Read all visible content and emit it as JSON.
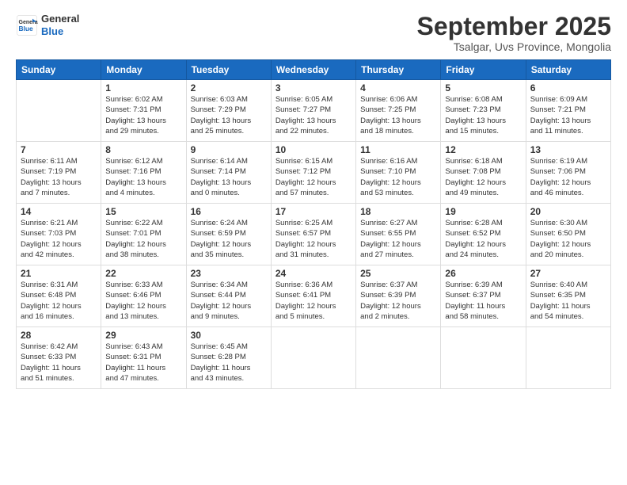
{
  "logo": {
    "line1": "General",
    "line2": "Blue"
  },
  "title": "September 2025",
  "location": "Tsalgar, Uvs Province, Mongolia",
  "days_of_week": [
    "Sunday",
    "Monday",
    "Tuesday",
    "Wednesday",
    "Thursday",
    "Friday",
    "Saturday"
  ],
  "weeks": [
    [
      {
        "day": "",
        "info": ""
      },
      {
        "day": "1",
        "info": "Sunrise: 6:02 AM\nSunset: 7:31 PM\nDaylight: 13 hours\nand 29 minutes."
      },
      {
        "day": "2",
        "info": "Sunrise: 6:03 AM\nSunset: 7:29 PM\nDaylight: 13 hours\nand 25 minutes."
      },
      {
        "day": "3",
        "info": "Sunrise: 6:05 AM\nSunset: 7:27 PM\nDaylight: 13 hours\nand 22 minutes."
      },
      {
        "day": "4",
        "info": "Sunrise: 6:06 AM\nSunset: 7:25 PM\nDaylight: 13 hours\nand 18 minutes."
      },
      {
        "day": "5",
        "info": "Sunrise: 6:08 AM\nSunset: 7:23 PM\nDaylight: 13 hours\nand 15 minutes."
      },
      {
        "day": "6",
        "info": "Sunrise: 6:09 AM\nSunset: 7:21 PM\nDaylight: 13 hours\nand 11 minutes."
      }
    ],
    [
      {
        "day": "7",
        "info": "Sunrise: 6:11 AM\nSunset: 7:19 PM\nDaylight: 13 hours\nand 7 minutes."
      },
      {
        "day": "8",
        "info": "Sunrise: 6:12 AM\nSunset: 7:16 PM\nDaylight: 13 hours\nand 4 minutes."
      },
      {
        "day": "9",
        "info": "Sunrise: 6:14 AM\nSunset: 7:14 PM\nDaylight: 13 hours\nand 0 minutes."
      },
      {
        "day": "10",
        "info": "Sunrise: 6:15 AM\nSunset: 7:12 PM\nDaylight: 12 hours\nand 57 minutes."
      },
      {
        "day": "11",
        "info": "Sunrise: 6:16 AM\nSunset: 7:10 PM\nDaylight: 12 hours\nand 53 minutes."
      },
      {
        "day": "12",
        "info": "Sunrise: 6:18 AM\nSunset: 7:08 PM\nDaylight: 12 hours\nand 49 minutes."
      },
      {
        "day": "13",
        "info": "Sunrise: 6:19 AM\nSunset: 7:06 PM\nDaylight: 12 hours\nand 46 minutes."
      }
    ],
    [
      {
        "day": "14",
        "info": "Sunrise: 6:21 AM\nSunset: 7:03 PM\nDaylight: 12 hours\nand 42 minutes."
      },
      {
        "day": "15",
        "info": "Sunrise: 6:22 AM\nSunset: 7:01 PM\nDaylight: 12 hours\nand 38 minutes."
      },
      {
        "day": "16",
        "info": "Sunrise: 6:24 AM\nSunset: 6:59 PM\nDaylight: 12 hours\nand 35 minutes."
      },
      {
        "day": "17",
        "info": "Sunrise: 6:25 AM\nSunset: 6:57 PM\nDaylight: 12 hours\nand 31 minutes."
      },
      {
        "day": "18",
        "info": "Sunrise: 6:27 AM\nSunset: 6:55 PM\nDaylight: 12 hours\nand 27 minutes."
      },
      {
        "day": "19",
        "info": "Sunrise: 6:28 AM\nSunset: 6:52 PM\nDaylight: 12 hours\nand 24 minutes."
      },
      {
        "day": "20",
        "info": "Sunrise: 6:30 AM\nSunset: 6:50 PM\nDaylight: 12 hours\nand 20 minutes."
      }
    ],
    [
      {
        "day": "21",
        "info": "Sunrise: 6:31 AM\nSunset: 6:48 PM\nDaylight: 12 hours\nand 16 minutes."
      },
      {
        "day": "22",
        "info": "Sunrise: 6:33 AM\nSunset: 6:46 PM\nDaylight: 12 hours\nand 13 minutes."
      },
      {
        "day": "23",
        "info": "Sunrise: 6:34 AM\nSunset: 6:44 PM\nDaylight: 12 hours\nand 9 minutes."
      },
      {
        "day": "24",
        "info": "Sunrise: 6:36 AM\nSunset: 6:41 PM\nDaylight: 12 hours\nand 5 minutes."
      },
      {
        "day": "25",
        "info": "Sunrise: 6:37 AM\nSunset: 6:39 PM\nDaylight: 12 hours\nand 2 minutes."
      },
      {
        "day": "26",
        "info": "Sunrise: 6:39 AM\nSunset: 6:37 PM\nDaylight: 11 hours\nand 58 minutes."
      },
      {
        "day": "27",
        "info": "Sunrise: 6:40 AM\nSunset: 6:35 PM\nDaylight: 11 hours\nand 54 minutes."
      }
    ],
    [
      {
        "day": "28",
        "info": "Sunrise: 6:42 AM\nSunset: 6:33 PM\nDaylight: 11 hours\nand 51 minutes."
      },
      {
        "day": "29",
        "info": "Sunrise: 6:43 AM\nSunset: 6:31 PM\nDaylight: 11 hours\nand 47 minutes."
      },
      {
        "day": "30",
        "info": "Sunrise: 6:45 AM\nSunset: 6:28 PM\nDaylight: 11 hours\nand 43 minutes."
      },
      {
        "day": "",
        "info": ""
      },
      {
        "day": "",
        "info": ""
      },
      {
        "day": "",
        "info": ""
      },
      {
        "day": "",
        "info": ""
      }
    ]
  ]
}
